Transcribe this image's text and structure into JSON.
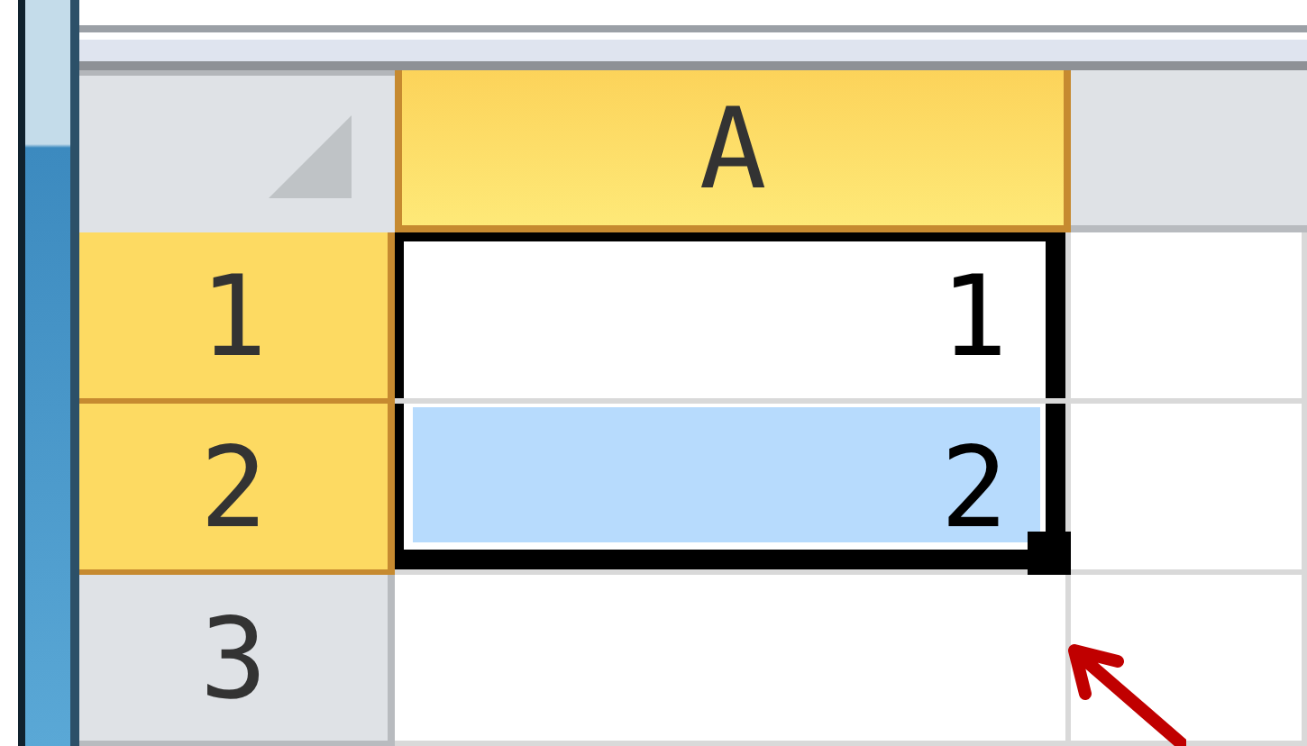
{
  "columns": [
    {
      "label": "A",
      "selected": true
    }
  ],
  "rows": [
    {
      "label": "1",
      "selected": true,
      "cells": [
        {
          "value": "1",
          "active": true,
          "selected": true
        }
      ]
    },
    {
      "label": "2",
      "selected": true,
      "cells": [
        {
          "value": "2",
          "active": false,
          "selected": true
        }
      ]
    },
    {
      "label": "3",
      "selected": false,
      "cells": [
        {
          "active": false,
          "selected": false
        }
      ]
    }
  ]
}
